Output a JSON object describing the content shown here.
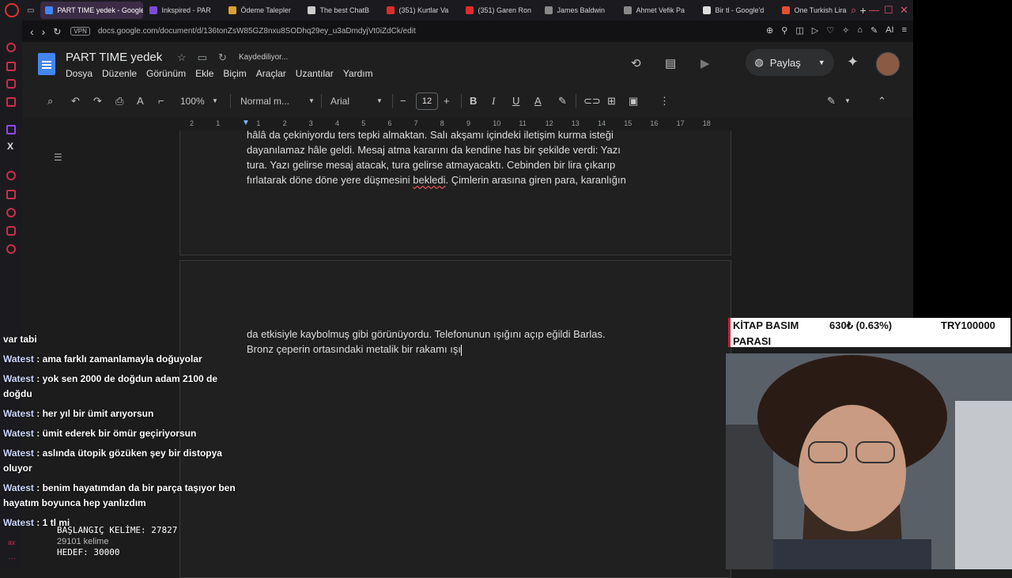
{
  "browser": {
    "tabs": [
      {
        "label": "PART TIME yedek - Google",
        "color": "#4285f4",
        "active": true
      },
      {
        "label": "Inkspired - PAR",
        "color": "#7b4bd6"
      },
      {
        "label": "Ödeme Talepler",
        "color": "#e0a030"
      },
      {
        "label": "The best ChatB",
        "color": "#cccccc"
      },
      {
        "label": "(351) Kurtlar Va",
        "color": "#e02b2b"
      },
      {
        "label": "(351) Garen Ron",
        "color": "#e02b2b"
      },
      {
        "label": "James Baldwin",
        "color": "#888888"
      },
      {
        "label": "Ahmet Vefik Pa",
        "color": "#888888"
      },
      {
        "label": "Bir tl - Google'd",
        "color": "#dddddd"
      },
      {
        "label": "One Turkish Lira",
        "color": "#e05030"
      }
    ],
    "new_tab": "+",
    "vpn": "VPN",
    "url": "docs.google.com/document/d/136tonZsW85GZ8nxu8SODhq29ey_u3aDmdyjVt0iZdCk/edit",
    "ai_label": "AI"
  },
  "docs": {
    "title": "PART TIME yedek",
    "saving": "Kaydediliyor...",
    "menu": [
      "Dosya",
      "Düzenle",
      "Görünüm",
      "Ekle",
      "Biçim",
      "Araçlar",
      "Uzantılar",
      "Yardım"
    ],
    "share": "Paylaş",
    "zoom": "100%",
    "style": "Normal m...",
    "font": "Arial",
    "font_size": "12",
    "ruler": [
      "2",
      "1",
      "1",
      "2",
      "3",
      "4",
      "5",
      "6",
      "7",
      "8",
      "9",
      "10",
      "11",
      "12",
      "13",
      "14",
      "15",
      "16",
      "17",
      "18"
    ],
    "page1": {
      "line1": "hâlâ da çekiniyordu ters tepki almaktan. Salı akşamı içindeki iletişim kurma isteği",
      "line2": "dayanılamaz hâle geldi. Mesaj atma kararını da kendine has bir şekilde verdi: Yazı",
      "line3": "tura. Yazı gelirse mesaj atacak, tura gelirse atmayacaktı. Cebinden bir lira çıkarıp",
      "line4_a": "fırlatarak döne döne yere düşmesini ",
      "line4_word": "bekledi",
      "line4_b": ". Çimlerin arasına giren para, karanlığın"
    },
    "page2": {
      "line1": "da etkisiyle kaybolmuş gibi görünüyordu. Telefonunun ışığını açıp eğildi Barlas.",
      "line2": "Bronz çeperin ortasındaki metalik bir rakamı ışı"
    }
  },
  "overlay": {
    "kitap_label": "KİTAP BASIM",
    "kitap_label2": "PARASI",
    "kitap_value": "630₺ (0.63%)",
    "kitap_target": "TRY100000",
    "chat_top": "var tabi",
    "chat": [
      {
        "user": "Watest",
        "text": ": ama farklı zamanlamayla doğuyolar"
      },
      {
        "user": "Watest",
        "text": ": yok sen 2000 de doğdun adam 2100 de doğdu"
      },
      {
        "user": "Watest",
        "text": ": her yıl bir ümit arıyorsun"
      },
      {
        "user": "Watest",
        "text": ": ümit ederek bir ömür geçiriyorsun"
      },
      {
        "user": "Watest",
        "text": ": aslında ütopik gözüken şey bir distopya oluyor"
      },
      {
        "user": "Watest",
        "text": ": benim hayatımdan da bir parça taşıyor ben hayatım boyunca hep yanlızdım"
      },
      {
        "user": "Watest",
        "text": ": 1 tl mi"
      }
    ],
    "start_words": "BAŞLANGIÇ KELİME: 27827",
    "word_count": "29101 kelime",
    "target": "HEDEF: 30000"
  },
  "colors": {
    "docs_bg": "#1c1c1c",
    "page_bg": "#202020",
    "accent": "#cc1f3e",
    "docs_blue": "#4285f4"
  }
}
